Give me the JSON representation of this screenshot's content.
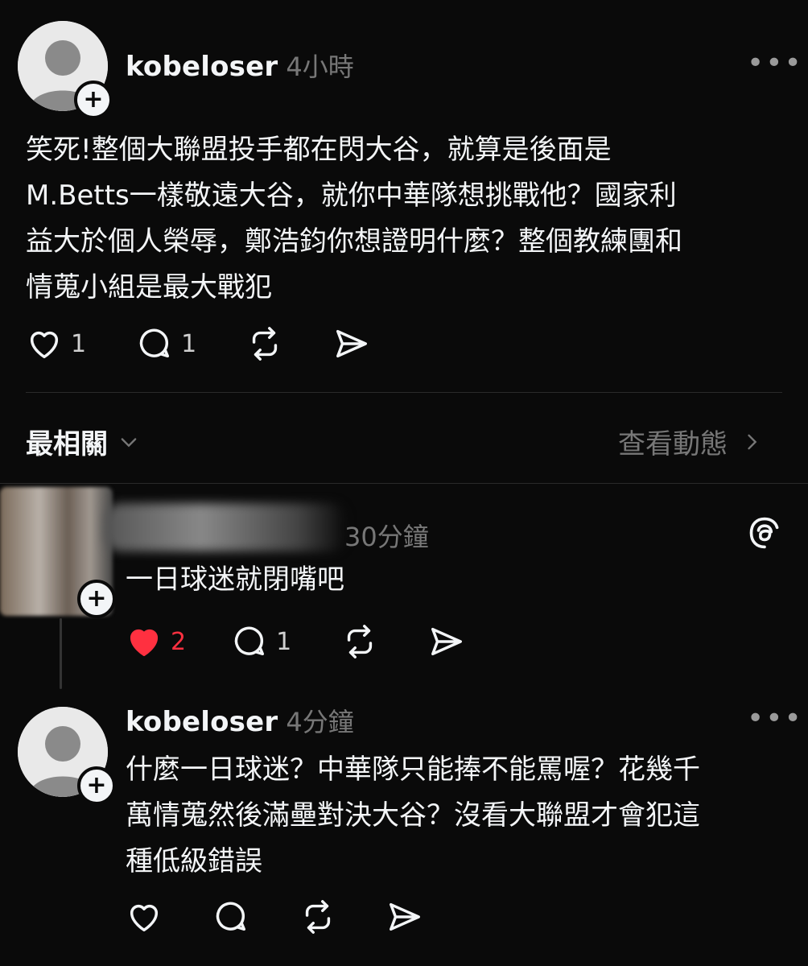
{
  "post": {
    "username": "kobeloser",
    "time": "4小時",
    "text": "笑死!整個大聯盟投手都在閃大谷，就算是後面是\nM.Betts一樣敬遠大谷，就你中華隊想挑戰他？國家利\n益大於個人榮辱，鄭浩鈞你想證明什麼？整個教練團和\n情蒐小組是最大戰犯",
    "likes": "1",
    "replies": "1"
  },
  "sort_bar": {
    "sort_label": "最相關",
    "activity_label": "查看動態"
  },
  "reply1": {
    "time": "30分鐘",
    "text": "一日球迷就閉嘴吧",
    "likes": "2",
    "replies": "1",
    "liked": true
  },
  "reply2": {
    "username": "kobeloser",
    "time": "4分鐘",
    "text": "什麼一日球迷？中華隊只能捧不能罵喔？花幾千\n萬情蒐然後滿壘對決大谷？沒看大聯盟才會犯這\n種低級錯誤"
  },
  "colors": {
    "background": "#0a0a0a",
    "text": "#f3f5f7",
    "muted": "#777777",
    "like_active": "#ff3040"
  },
  "icons": [
    "plus-icon",
    "more-icon",
    "heart-icon",
    "comment-icon",
    "repost-icon",
    "share-icon",
    "chevron-down-icon",
    "chevron-right-icon",
    "threads-logo-icon"
  ]
}
